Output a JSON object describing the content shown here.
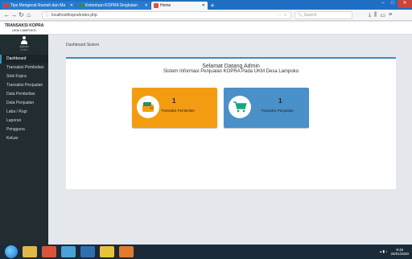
{
  "browser": {
    "tabs": [
      {
        "label": "Tips Mengecat Rumah dan Ma",
        "fav_color": "#e23b2e"
      },
      {
        "label": "Ketentuan KOPRA Singkatan",
        "fav_color": "#2e8b57"
      },
      {
        "label": "Home",
        "fav_color": "#e84c3d",
        "active": true
      }
    ],
    "url": "localhost/kopra/index.php",
    "search_placeholder": "Search"
  },
  "app": {
    "brand_title": "TRANSAKSI KOPRA",
    "brand_sub": "UKM LAMPOKO",
    "user_name": "Admin",
    "user_status": "Online"
  },
  "sidebar": {
    "items": [
      {
        "label": "Dashboard",
        "active": true
      },
      {
        "label": "Transaksi Pembelian"
      },
      {
        "label": "Stok Kopra"
      },
      {
        "label": "Transaksi Penjualan"
      },
      {
        "label": "Data Pembelian"
      },
      {
        "label": "Data Penjualan"
      },
      {
        "label": "Laba / Rugi"
      },
      {
        "label": "Laporan"
      },
      {
        "label": "Pengguna"
      },
      {
        "label": "Keluar"
      }
    ]
  },
  "content": {
    "breadcrumb": "Dashboard Sistem",
    "welcome_title": "Selamat Datang Admin",
    "welcome_sub": "Sistem Informasi Penjualan KOPRA Pada UKM Desa Lampoko",
    "cards": [
      {
        "count": "1",
        "label": "Transaksi Pembelian",
        "color": "#f39c12"
      },
      {
        "count": "1",
        "label": "Transaksi Penjualan",
        "color": "#4a90c9"
      }
    ]
  },
  "taskbar": {
    "time": "9:45",
    "date": "20/01/2020"
  }
}
